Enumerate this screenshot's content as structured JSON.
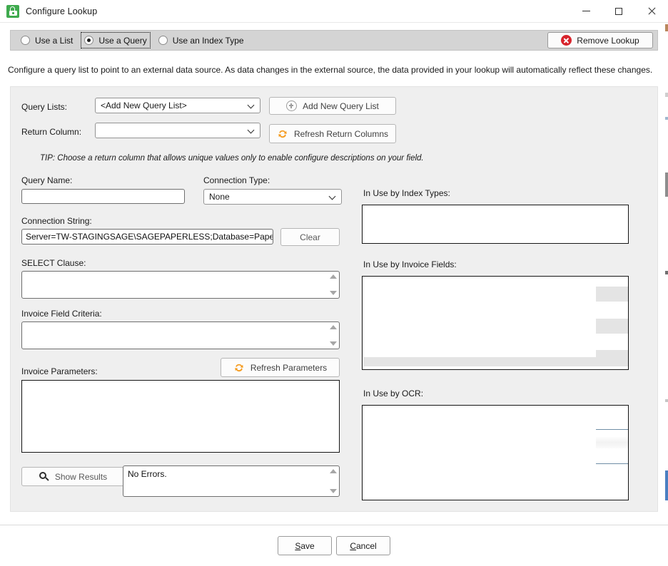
{
  "window": {
    "title": "Configure Lookup",
    "app_icon": "lock-icon",
    "accent_green": "#3faa4e",
    "controls": {
      "minimize": "minimize-icon",
      "maximize": "maximize-icon",
      "close": "close-icon"
    }
  },
  "mode_bar": {
    "options": [
      {
        "label": "Use a List",
        "selected": false,
        "focused": false
      },
      {
        "label": "Use a Query",
        "selected": true,
        "focused": true
      },
      {
        "label": "Use an Index Type",
        "selected": false,
        "focused": false
      }
    ],
    "remove_lookup": {
      "label": "Remove Lookup",
      "icon": "remove-circle-icon",
      "icon_color": "#d8242c"
    }
  },
  "description": "Configure a query list to point to an external data source. As data changes in the external source, the data provided in your lookup will automatically reflect these changes.",
  "form": {
    "query_lists_label": "Query Lists:",
    "query_lists_value": "<Add New Query List>",
    "return_column_label": "Return Column:",
    "return_column_value": "",
    "add_new_query_list_button": "Add New Query List",
    "refresh_return_columns_button": "Refresh Return Columns",
    "tip": "TIP: Choose a return column that allows unique values only to enable configure descriptions on your field.",
    "query_name_label": "Query Name:",
    "query_name_value": "",
    "connection_type_label": "Connection Type:",
    "connection_type_value": "None",
    "connection_string_label": "Connection String:",
    "connection_string_value": "Server=TW-STAGINGSAGE\\SAGEPAPERLESS;Database=PaperlessEr",
    "clear_button": "Clear",
    "select_clause_label": "SELECT Clause:",
    "select_clause_value": "",
    "invoice_field_criteria_label": "Invoice Field Criteria:",
    "invoice_field_criteria_value": "",
    "invoice_parameters_label": "Invoice Parameters:",
    "invoice_parameters_value": "",
    "refresh_parameters_button": "Refresh Parameters",
    "show_results_button": "Show Results",
    "errors_value": "No Errors."
  },
  "usage": {
    "index_types_label": "In Use by Index Types:",
    "index_types_items": [],
    "invoice_fields_label": "In Use by Invoice Fields:",
    "invoice_fields_items": [],
    "ocr_label": "In Use by OCR:",
    "ocr_items": []
  },
  "footer": {
    "save_label": "Save",
    "save_accel": "S",
    "cancel_label": "Cancel",
    "cancel_accel": "C"
  },
  "icons": {
    "refresh": "refresh-icon",
    "plus_circle": "plus-circle-icon",
    "search": "search-icon",
    "chevron_down": "chevron-down-icon"
  }
}
